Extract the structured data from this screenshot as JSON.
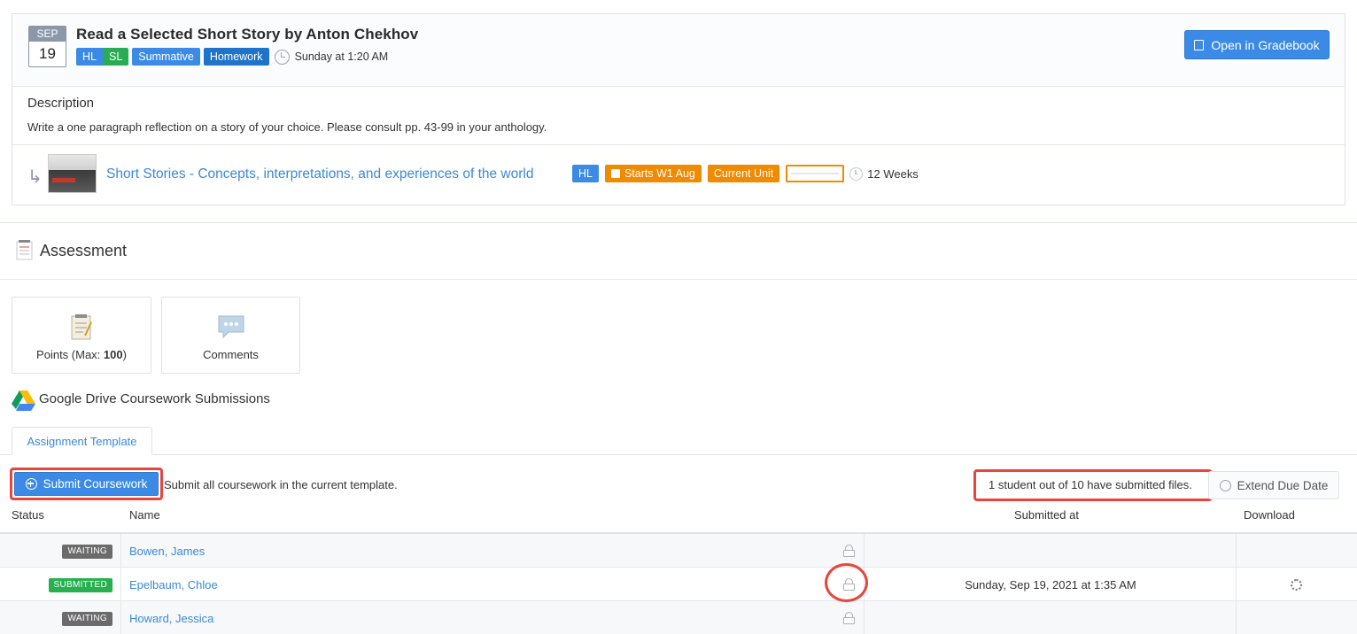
{
  "assignment": {
    "date_month": "SEP",
    "date_day": "19",
    "title": "Read a Selected Short Story by Anton Chekhov",
    "tags": [
      "HL",
      "SL",
      "Summative",
      "Homework"
    ],
    "due": "Sunday at 1:20 AM",
    "gradebook_button": "Open in Gradebook"
  },
  "description": {
    "label": "Description",
    "text": "Write a one paragraph reflection on a story of your choice. Please consult pp. 43-99 in your anthology."
  },
  "unit": {
    "link": "Short Stories - Concepts, interpretations, and experiences of the world",
    "level_tag": "HL",
    "start_tag": "Starts W1 Aug",
    "current_tag": "Current Unit",
    "progress": 0,
    "duration": "12 Weeks"
  },
  "assessment": {
    "title": "Assessment",
    "points_label_prefix": "Points (Max: ",
    "points_max": "100",
    "points_label_suffix": ")",
    "comments_label": "Comments"
  },
  "drive": {
    "title": "Google Drive Coursework Submissions",
    "tab": "Assignment Template"
  },
  "toolbar": {
    "submit_button": "Submit Coursework",
    "submit_hint": "Submit all coursework in the current template.",
    "submission_count": "1 student out of 10 have submitted files.",
    "extend_button": "Extend Due Date"
  },
  "table": {
    "headers": {
      "status": "Status",
      "name": "Name",
      "submitted_at": "Submitted at",
      "download": "Download"
    },
    "rows": [
      {
        "status": "WAITING",
        "name": "Bowen, James",
        "submitted_at": ""
      },
      {
        "status": "SUBMITTED",
        "name": "Epelbaum, Chloe",
        "submitted_at": "Sunday, Sep 19, 2021 at 1:35 AM"
      },
      {
        "status": "WAITING",
        "name": "Howard, Jessica",
        "submitted_at": ""
      }
    ]
  },
  "colors": {
    "accent": "#3b8be6",
    "submitted": "#27b04f",
    "waiting": "#6b6b6b",
    "warning": "#f08a00",
    "highlight": "#e8463c"
  }
}
